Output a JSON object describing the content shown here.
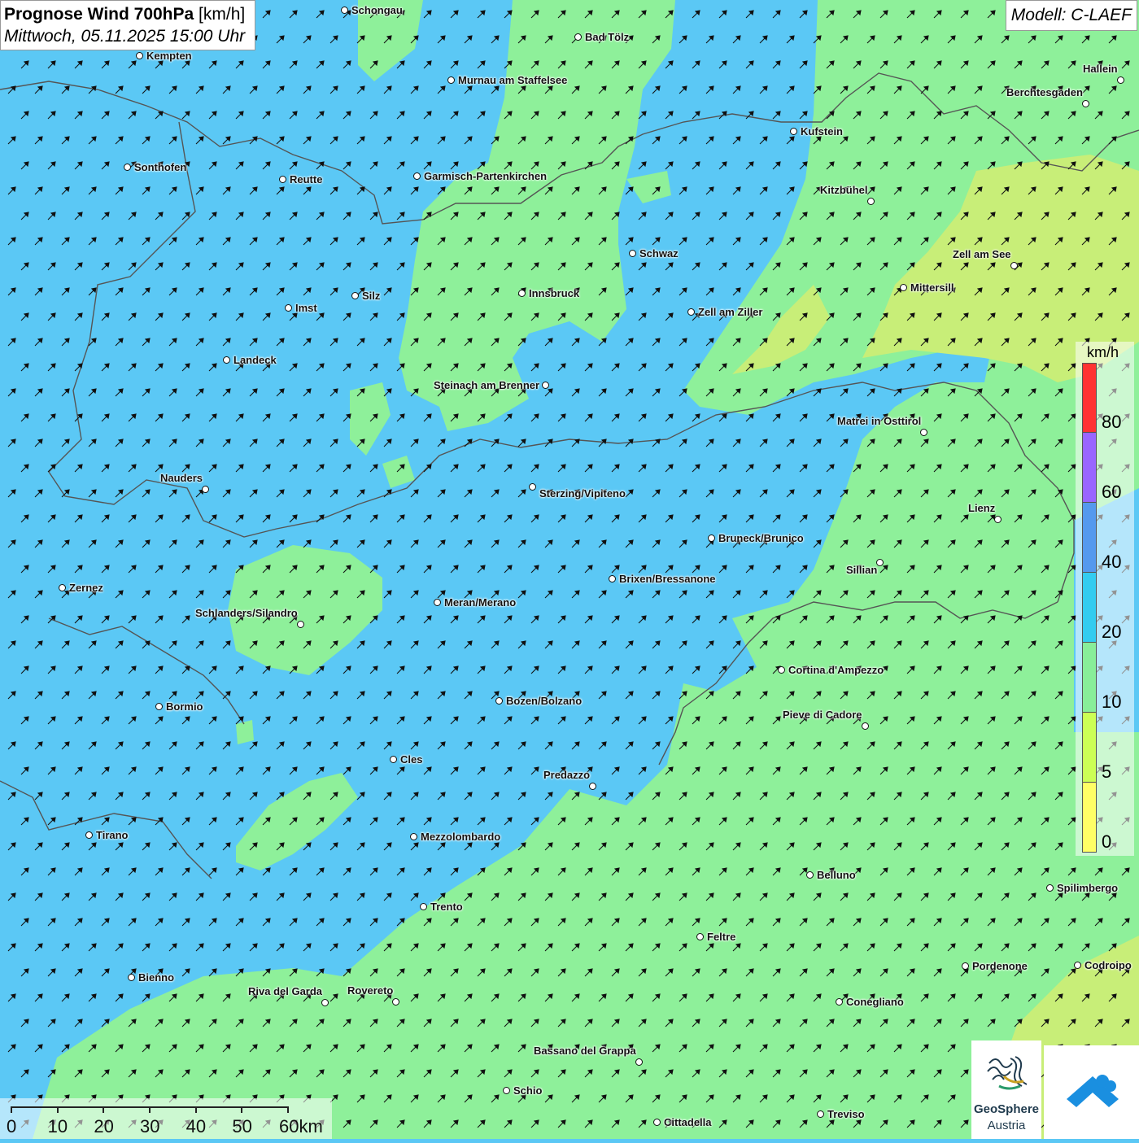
{
  "header": {
    "title_bold": "Prognose Wind 700hPa",
    "title_unit": " [km/h]",
    "subtitle": "Mittwoch, 05.11.2025 15:00 Uhr"
  },
  "model_label": "Modell: C-LAEF",
  "legend": {
    "unit": "km/h",
    "colors": [
      "#ff3333",
      "#9966ff",
      "#5599ee",
      "#33ccf0",
      "#88ee99",
      "#ccff55",
      "#ffff66"
    ],
    "ticks": [
      "80",
      "60",
      "40",
      "20",
      "10",
      "5",
      "0"
    ]
  },
  "scale_bar": {
    "labels": [
      "0",
      "10",
      "20",
      "30",
      "40",
      "50",
      "60km"
    ]
  },
  "logos": {
    "geosphere_name": "GeoSphere",
    "geosphere_sub": "Austria"
  },
  "map_colors": {
    "strong_wind": "#5bc8f5",
    "moderate_wind": "#8ef09a",
    "light_wind": "#c8ee78",
    "borders": "#555555",
    "arrows": "#111111"
  },
  "cities": [
    {
      "name": "Schongau"
    },
    {
      "name": "Bad Tölz"
    },
    {
      "name": "Kempten"
    },
    {
      "name": "Murnau am Staffelsee"
    },
    {
      "name": "Hallein"
    },
    {
      "name": "Berchtesgaden"
    },
    {
      "name": "Kufstein"
    },
    {
      "name": "Sonthofen"
    },
    {
      "name": "Reutte"
    },
    {
      "name": "Garmisch-Partenkirchen"
    },
    {
      "name": "Kitzbühel"
    },
    {
      "name": "Schwaz"
    },
    {
      "name": "Zell am See"
    },
    {
      "name": "Mittersill"
    },
    {
      "name": "Innsbruck"
    },
    {
      "name": "Silz"
    },
    {
      "name": "Imst"
    },
    {
      "name": "Zell am Ziller"
    },
    {
      "name": "Landeck"
    },
    {
      "name": "Steinach am Brenner"
    },
    {
      "name": "Matrei in Osttirol"
    },
    {
      "name": "Nauders"
    },
    {
      "name": "Sterzing/Vipiteno"
    },
    {
      "name": "Lienz"
    },
    {
      "name": "Bruneck/Brunico"
    },
    {
      "name": "Sillian"
    },
    {
      "name": "Zernez"
    },
    {
      "name": "Brixen/Bressanone"
    },
    {
      "name": "Meran/Merano"
    },
    {
      "name": "Schlanders/Silandro"
    },
    {
      "name": "Cortina d'Ampezzo"
    },
    {
      "name": "Bormio"
    },
    {
      "name": "Bozen/Bolzano"
    },
    {
      "name": "Pieve di Cadore"
    },
    {
      "name": "Cles"
    },
    {
      "name": "Predazzo"
    },
    {
      "name": "Tirano"
    },
    {
      "name": "Mezzolombardo"
    },
    {
      "name": "Belluno"
    },
    {
      "name": "Spilimbergo"
    },
    {
      "name": "Trento"
    },
    {
      "name": "Feltre"
    },
    {
      "name": "Bienno"
    },
    {
      "name": "Pordenone"
    },
    {
      "name": "Codroipo"
    },
    {
      "name": "Riva del Garda"
    },
    {
      "name": "Rovereto"
    },
    {
      "name": "Conegliano"
    },
    {
      "name": "Bassano del Grappa"
    },
    {
      "name": "Schio"
    },
    {
      "name": "Treviso"
    },
    {
      "name": "Cittadella"
    }
  ]
}
